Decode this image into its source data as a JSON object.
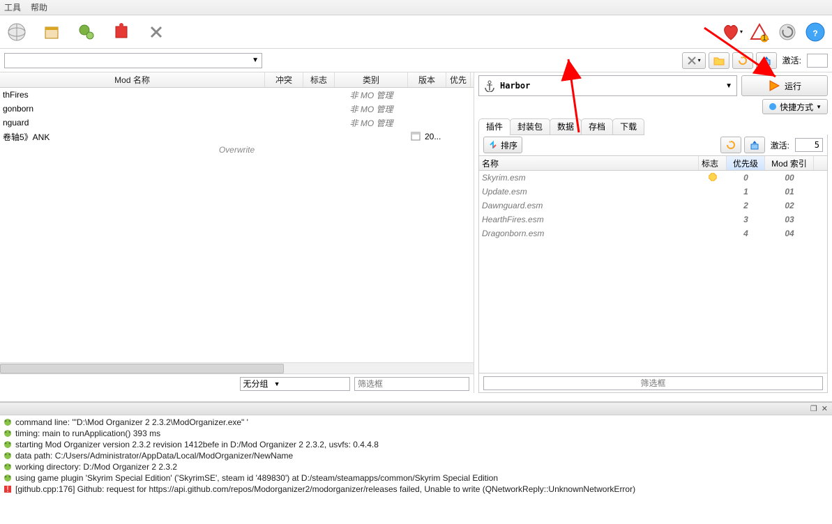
{
  "menu": {
    "tools": "工具",
    "help": "帮助"
  },
  "toolbar": {
    "profile": {
      "placeholder": ""
    }
  },
  "sec_bar": {
    "tools_btn": "",
    "open_btn": "",
    "restore_btn": "",
    "backup_btn": "",
    "active_label": "激活:",
    "active_value": ""
  },
  "mod_table": {
    "headers": {
      "name": "Mod 名称",
      "conflict": "冲突",
      "flag": "标志",
      "category": "类别",
      "version": "版本",
      "priority": "优先"
    },
    "rows": [
      {
        "name": "thFires",
        "category": "非 MO 管理"
      },
      {
        "name": "gonborn",
        "category": "非 MO 管理"
      },
      {
        "name": "nguard",
        "category": "非 MO 管理"
      },
      {
        "name": "卷轴5》ANK",
        "date_icon": true,
        "version": "20..."
      }
    ],
    "overwrite": "Overwrite"
  },
  "bottom_left": {
    "group": "无分组",
    "filter_ph": "筛选框"
  },
  "right": {
    "executable": "Harbor",
    "run": "运行",
    "shortcut": "快捷方式",
    "tabs": {
      "plugins": "插件",
      "packages": "封装包",
      "data": "数据",
      "archives": "存档",
      "downloads": "下载"
    },
    "plugin_bar": {
      "sort": "排序",
      "active_label": "激活:",
      "active_value": "5"
    },
    "plugin_headers": {
      "name": "名称",
      "flag": "标志",
      "priority": "优先级",
      "mod_index": "Mod 索引"
    },
    "plugins": [
      {
        "name": "Skyrim.esm",
        "flag": true,
        "priority": "0",
        "index": "00"
      },
      {
        "name": "Update.esm",
        "priority": "1",
        "index": "01"
      },
      {
        "name": "Dawnguard.esm",
        "priority": "2",
        "index": "02"
      },
      {
        "name": "HearthFires.esm",
        "priority": "3",
        "index": "03"
      },
      {
        "name": "Dragonborn.esm",
        "priority": "4",
        "index": "04"
      }
    ],
    "filter_ph": "筛选框"
  },
  "log": [
    {
      "type": "info",
      "text": "command line: '\"D:\\Mod Organizer 2 2.3.2\\ModOrganizer.exe\" '"
    },
    {
      "type": "info",
      "text": "timing: main to runApplication() 393 ms"
    },
    {
      "type": "info",
      "text": "starting Mod Organizer version 2.3.2 revision 1412befe in D:/Mod Organizer 2 2.3.2, usvfs: 0.4.4.8"
    },
    {
      "type": "info",
      "text": "data path: C:/Users/Administrator/AppData/Local/ModOrganizer/NewName"
    },
    {
      "type": "info",
      "text": "working directory: D:/Mod Organizer 2 2.3.2"
    },
    {
      "type": "info",
      "text": "using game plugin 'Skyrim Special Edition' ('SkyrimSE', steam id '489830') at D:/steam/steamapps/common/Skyrim Special Edition"
    },
    {
      "type": "error",
      "text": "[github.cpp:176] Github: request for https://api.github.com/repos/Modorganizer2/modorganizer/releases failed, Unable to write (QNetworkReply::UnknownNetworkError)"
    }
  ]
}
